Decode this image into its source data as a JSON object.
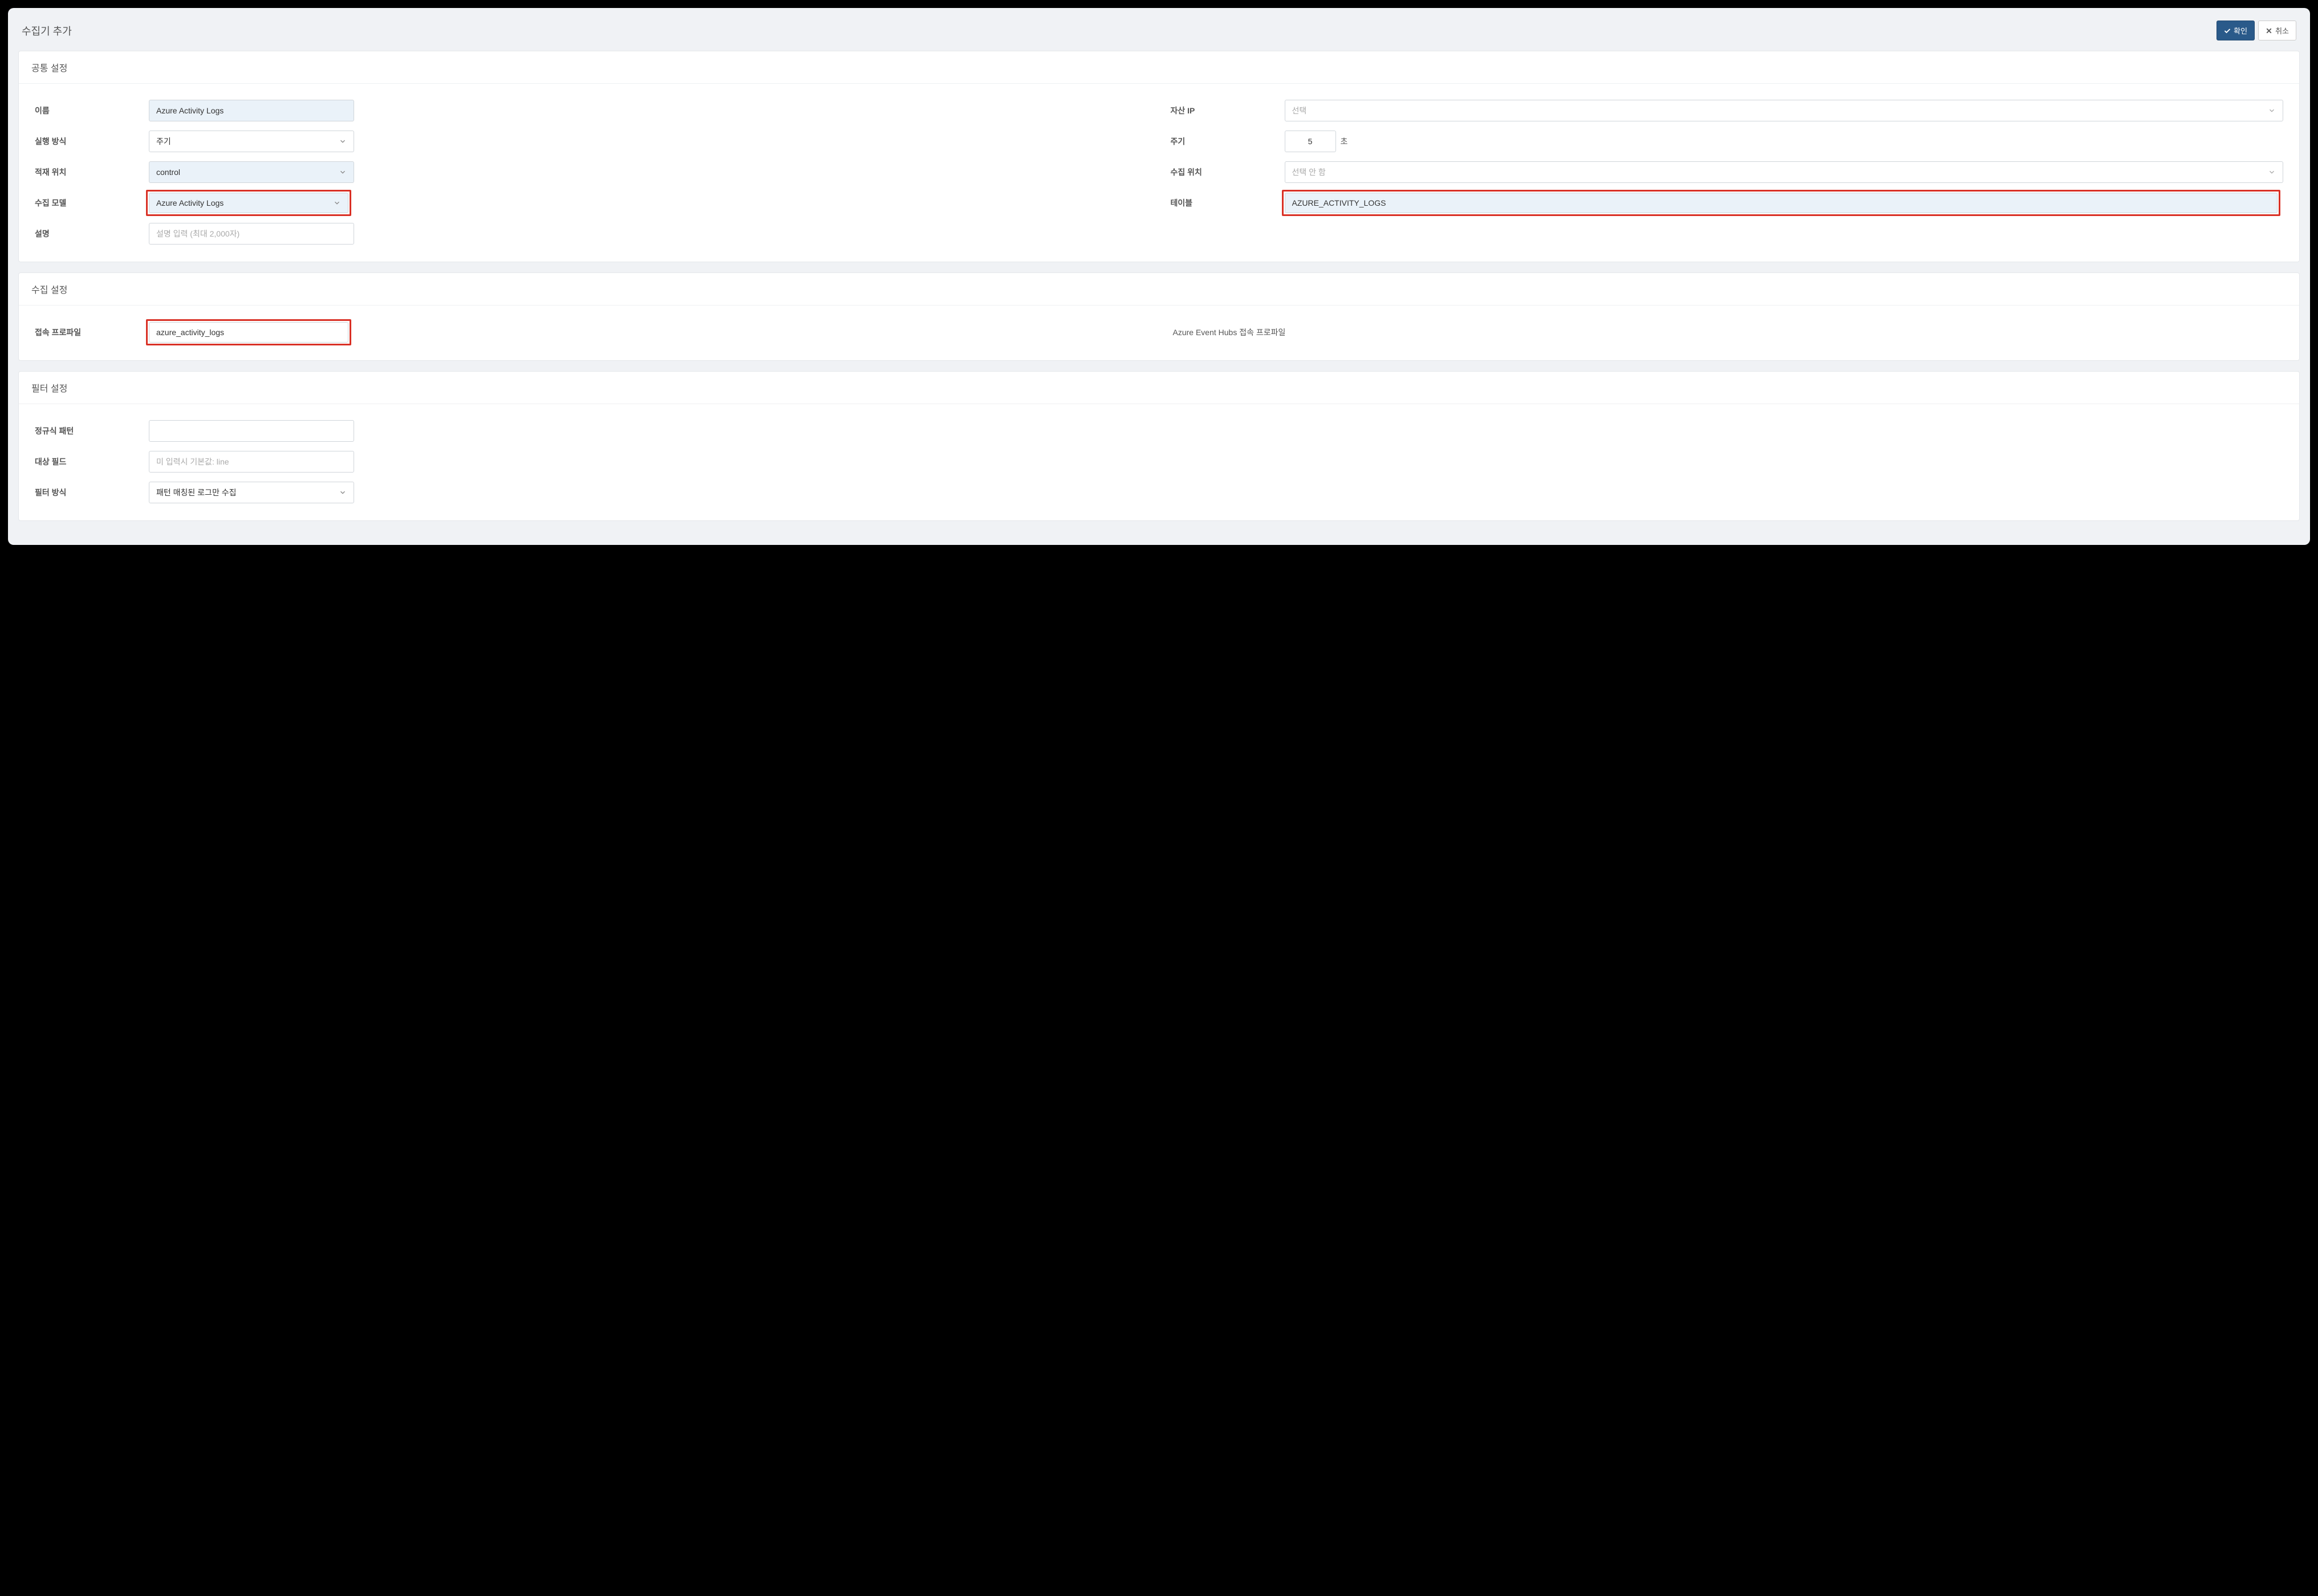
{
  "header": {
    "title": "수집기 추가",
    "confirm_label": "확인",
    "cancel_label": "취소"
  },
  "common_settings": {
    "title": "공통 설정",
    "name_label": "이름",
    "name_value": "Azure Activity Logs",
    "exec_mode_label": "실행 방식",
    "exec_mode_value": "주기",
    "load_location_label": "적재 위치",
    "load_location_value": "control",
    "collect_model_label": "수집 모델",
    "collect_model_value": "Azure Activity Logs",
    "description_label": "설명",
    "description_placeholder": "설명 입력 (최대 2,000자)",
    "asset_ip_label": "자산 IP",
    "asset_ip_placeholder": "선택",
    "period_label": "주기",
    "period_value": "5",
    "period_unit": "초",
    "collect_location_label": "수집 위치",
    "collect_location_placeholder": "선택 안 함",
    "table_label": "테이블",
    "table_value": "AZURE_ACTIVITY_LOGS"
  },
  "collect_settings": {
    "title": "수집 설정",
    "profile_label": "접속 프로파일",
    "profile_value": "azure_activity_logs",
    "profile_desc": "Azure Event Hubs 접속 프로파일"
  },
  "filter_settings": {
    "title": "필터 설정",
    "regex_label": "정규식 패턴",
    "regex_value": "",
    "target_field_label": "대상 필드",
    "target_field_placeholder": "미 입력시 기본값: line",
    "filter_mode_label": "필터 방식",
    "filter_mode_value": "패턴 매칭된 로그만 수집"
  }
}
